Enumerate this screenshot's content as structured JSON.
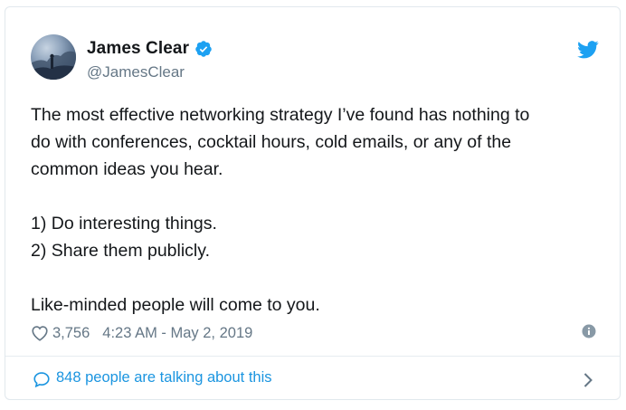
{
  "author": {
    "name": "James Clear",
    "handle": "@JamesClear",
    "verified": true
  },
  "tweet": {
    "lines": [
      "The most effective networking strategy I’ve found has nothing to",
      "do with conferences, cocktail hours, cold emails, or any of the",
      "common ideas you hear.",
      "",
      "1) Do interesting things.",
      "2) Share them publicly.",
      "",
      "Like-minded people will come to you."
    ]
  },
  "meta": {
    "likes": "3,756",
    "timestamp": "4:23 AM - May 2, 2019"
  },
  "footer": {
    "talking": "848 people are talking about this"
  },
  "colors": {
    "accent": "#1da1f2",
    "link": "#1b95e0",
    "muted": "#657786",
    "text": "#14171a"
  },
  "icons": {
    "verified": "verified-badge-icon",
    "brand": "twitter-bird-icon",
    "like": "heart-icon",
    "info": "info-icon",
    "conversation": "speech-bubble-icon",
    "more": "chevron-right-icon"
  }
}
